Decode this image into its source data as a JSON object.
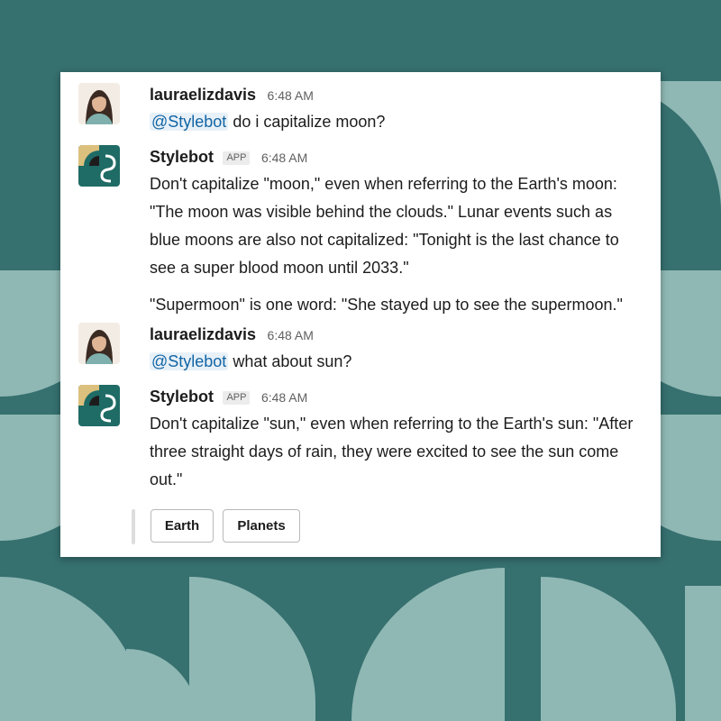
{
  "messages": [
    {
      "sender": "lauraelizdavis",
      "time": "6:48 AM",
      "avatar_icon": "user-avatar",
      "mention": "@Stylebot",
      "text": " do i capitalize moon?"
    },
    {
      "sender": "Stylebot",
      "badge": "APP",
      "time": "6:48 AM",
      "avatar_icon": "stylebot-logo",
      "paragraphs": [
        "Don't capitalize \"moon,\" even when referring to the Earth's moon: \"The moon was visible behind the clouds.\" Lunar events such as blue moons are also not capitalized: \"Tonight is the last chance to see a super blood moon until 2033.\"",
        "\"Supermoon\" is one word: \"She stayed up to see the supermoon.\""
      ]
    },
    {
      "sender": "lauraelizdavis",
      "time": "6:48 AM",
      "avatar_icon": "user-avatar",
      "mention": "@Stylebot",
      "text": " what about sun?"
    },
    {
      "sender": "Stylebot",
      "badge": "APP",
      "time": "6:48 AM",
      "avatar_icon": "stylebot-logo",
      "paragraphs": [
        "Don't capitalize \"sun,\" even when referring to the Earth's sun: \"After three straight days of rain, they were excited to see the sun come out.\""
      ]
    }
  ],
  "actions": [
    "Earth",
    "Planets"
  ],
  "colors": {
    "background": "#36706f",
    "pattern": "#8fb8b4",
    "stylebot_teal": "#1f6b66",
    "stylebot_gold": "#dcc07d",
    "mention_text": "#1264a3",
    "mention_bg": "#e8f1f8"
  }
}
